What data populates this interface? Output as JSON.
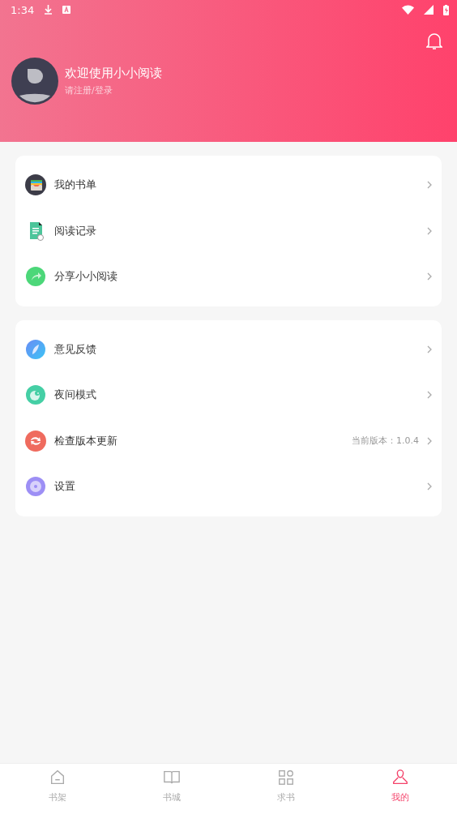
{
  "status_bar": {
    "time": "1:34"
  },
  "profile": {
    "title": "欢迎使用小小阅读",
    "subtitle": "请注册/登录"
  },
  "menu_groups": [
    {
      "items": [
        {
          "kind": "wallet",
          "label": "我的书单"
        },
        {
          "kind": "document",
          "label": "阅读记录"
        },
        {
          "kind": "share",
          "label": "分享小小阅读"
        }
      ]
    },
    {
      "items": [
        {
          "kind": "feather",
          "label": "意见反馈"
        },
        {
          "kind": "moon",
          "label": "夜间模式"
        },
        {
          "kind": "refresh",
          "label": "检查版本更新",
          "value": "当前版本：1.0.4"
        },
        {
          "kind": "settings",
          "label": "设置"
        }
      ]
    }
  ],
  "tab_bar": [
    {
      "kind": "shelf",
      "label": "书架",
      "selected": false
    },
    {
      "kind": "store",
      "label": "书城",
      "selected": false
    },
    {
      "kind": "request",
      "label": "求书",
      "selected": false
    },
    {
      "kind": "me",
      "label": "我的",
      "selected": true
    }
  ]
}
